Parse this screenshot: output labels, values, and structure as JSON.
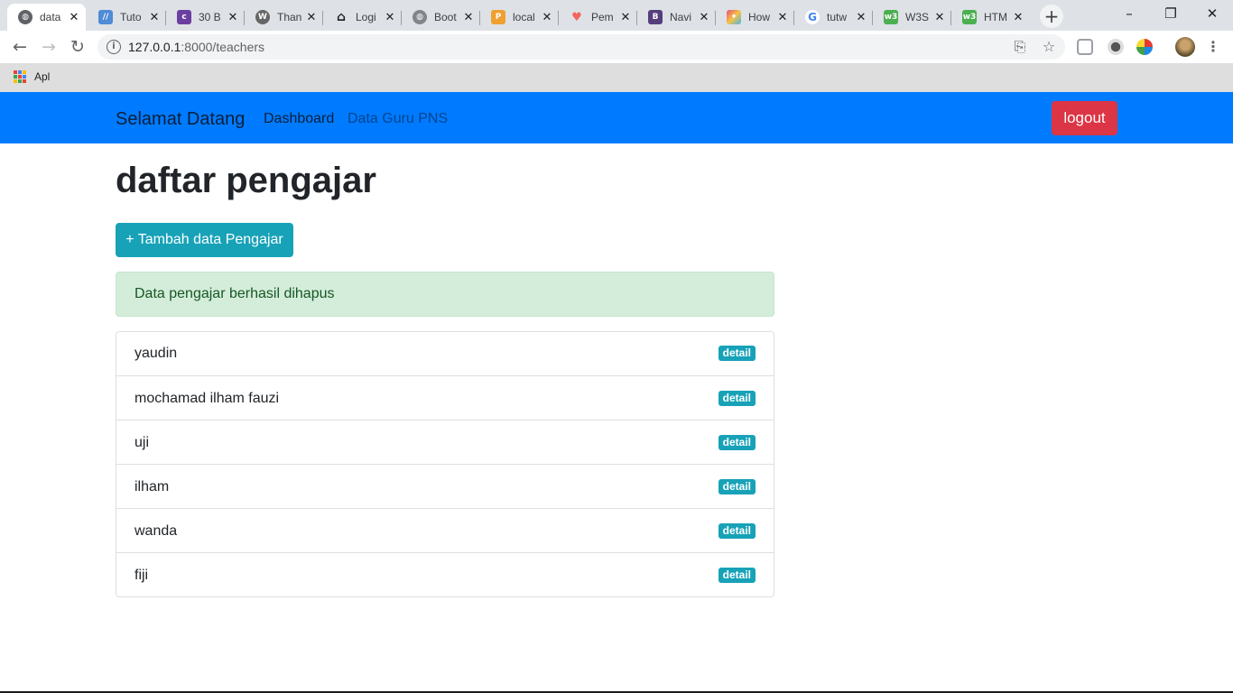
{
  "browser": {
    "tabs": [
      {
        "title": "data",
        "icon": "globe-icon",
        "active": true
      },
      {
        "title": "Tuto",
        "icon": "codepen-icon"
      },
      {
        "title": "30 B",
        "icon": "colorlib-icon"
      },
      {
        "title": "Than",
        "icon": "wordpress-icon"
      },
      {
        "title": "Logi",
        "icon": "home-icon"
      },
      {
        "title": "Boot",
        "icon": "globe-icon"
      },
      {
        "title": "local",
        "icon": "phpmyadmin-icon"
      },
      {
        "title": "Pem",
        "icon": "laravel-icon"
      },
      {
        "title": "Navi",
        "icon": "bootstrap-icon"
      },
      {
        "title": "How",
        "icon": "stackpath-icon"
      },
      {
        "title": "tutw",
        "icon": "google-icon"
      },
      {
        "title": "W3S",
        "icon": "w3schools-icon"
      },
      {
        "title": "HTM",
        "icon": "w3schools-icon"
      }
    ],
    "url_host": "127.0.0.1",
    "url_path": ":8000/teachers",
    "bookmarks": {
      "apps_label": "Apl"
    }
  },
  "navbar": {
    "brand": "Selamat Datang",
    "links": [
      "Dashboard",
      "Data Guru PNS"
    ],
    "logout": "logout"
  },
  "main": {
    "title": "daftar pengajar",
    "add_button": "+ Tambah data Pengajar",
    "alert": "Data pengajar berhasil dihapus",
    "teachers": [
      {
        "name": "yaudin",
        "badge": "detail"
      },
      {
        "name": "mochamad ilham fauzi",
        "badge": "detail"
      },
      {
        "name": "uji",
        "badge": "detail"
      },
      {
        "name": "ilham",
        "badge": "detail"
      },
      {
        "name": "wanda",
        "badge": "detail"
      },
      {
        "name": "fiji",
        "badge": "detail"
      }
    ]
  },
  "colors": {
    "navbar": "#007bff",
    "danger": "#dc3545",
    "info": "#17a2b8",
    "success_bg": "#d4edda",
    "success_text": "#155724"
  }
}
